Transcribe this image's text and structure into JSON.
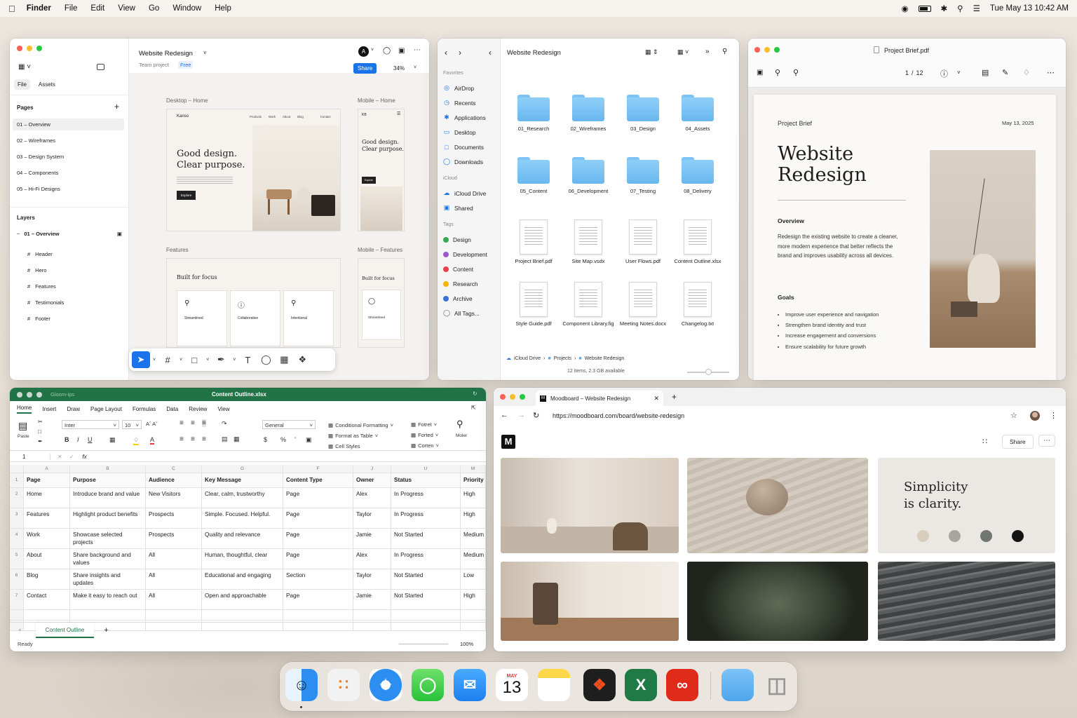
{
  "menubar": {
    "app": "Finder",
    "items": [
      "File",
      "Edit",
      "View",
      "Go",
      "Window",
      "Help"
    ],
    "datetime": "Tue May 13  10:42 AM"
  },
  "figma": {
    "title": "Website Redesign",
    "subtitle": "Team project",
    "plan": "Free",
    "avatar": "A",
    "share": "Share",
    "zoom": "34%",
    "tabs": [
      "File",
      "Assets"
    ],
    "pages_title": "Pages",
    "pages": [
      "01 – Overview",
      "02 – Wireframes",
      "03 – Design System",
      "04 – Components",
      "05 – Hi-Fi Designs"
    ],
    "layers_title": "Layers",
    "layer_root": "01 – Overview",
    "layers": [
      "Header",
      "Hero",
      "Features",
      "Testimonials",
      "Footer"
    ],
    "frames": {
      "desktop_home": "Desktop – Home",
      "mobile_home": "Mobile – Home",
      "features": "Features",
      "mobile_features": "Mobile – Features"
    },
    "hero": {
      "logo": "Kanso",
      "nav": [
        "Products",
        "Work",
        "About",
        "Blog",
        "Contact"
      ],
      "headline1": "Good design.",
      "headline2": "Clear purpose.",
      "cta": "Explore",
      "mobile_logo": "KB"
    },
    "feat": {
      "title": "Built for focus",
      "cards": [
        "Streamlined",
        "Collaborative",
        "Intentional"
      ]
    }
  },
  "finder": {
    "title": "Website Redesign",
    "favorites_title": "Favorites",
    "favorites": [
      {
        "icon": "airdrop-icon",
        "label": "AirDrop"
      },
      {
        "icon": "recents-icon",
        "label": "Recents"
      },
      {
        "icon": "applications-icon",
        "label": "Applications"
      },
      {
        "icon": "desktop-icon",
        "label": "Desktop"
      },
      {
        "icon": "documents-icon",
        "label": "Documents"
      },
      {
        "icon": "downloads-icon",
        "label": "Downloads"
      }
    ],
    "icloud_title": "iCloud",
    "icloud": [
      "iCloud Drive",
      "Shared"
    ],
    "tags_title": "Tags",
    "tags": [
      {
        "label": "Design",
        "color": "#34a853"
      },
      {
        "label": "Development",
        "color": "#9b59d0"
      },
      {
        "label": "Content",
        "color": "#e8414a"
      },
      {
        "label": "Research",
        "color": "#f4b400"
      },
      {
        "label": "Archive",
        "color": "#3b6fd8"
      },
      {
        "label": "All Tags...",
        "color": ""
      }
    ],
    "folders": [
      "01_Research",
      "02_Wireframes",
      "03_Design",
      "04_Assets",
      "05_Content",
      "06_Development",
      "07_Testing",
      "08_Delivery"
    ],
    "files": [
      "Project Brief.pdf",
      "Site Map.vsdx",
      "User Flows.pdf",
      "Content Outline.xlsx",
      "Style Guide.pdf",
      "Component Library.fig",
      "Meeting Notes.docx",
      "Changelog.txt"
    ],
    "path": [
      "iCloud Drive",
      "Projects",
      "Website Redesign"
    ],
    "status": "12 items, 2.3 GB available"
  },
  "pdf": {
    "title": "Project Brief.pdf",
    "page": "1",
    "pages": "12",
    "kicker": "Project Brief",
    "date": "May 13, 2025",
    "h1a": "Website",
    "h1b": "Redesign",
    "overview_title": "Overview",
    "overview": "Redesign the existing website to create a cleaner, more modern experience that better reflects the brand and improves usability across all devices.",
    "goals_title": "Goals",
    "goals": [
      "Improve user experience and navigation",
      "Strengthen brand identity and trust",
      "Increase engagement and conversions",
      "Ensure scalability for future growth"
    ]
  },
  "excel": {
    "title": "Content Outline.xlsx",
    "left_title": "Gloom-ips",
    "tabs": [
      "Home",
      "Insert",
      "Draw",
      "Page Layout",
      "Formulas",
      "Data",
      "Review",
      "View"
    ],
    "font": "Inter",
    "size": "10",
    "numfmt": "General",
    "paste": "Paste",
    "styles": [
      "Conditional Formatting",
      "Format as Table",
      "Cell Styles"
    ],
    "cells": [
      "Fotret",
      "Forted",
      "Corten"
    ],
    "moler": "Moler",
    "namebox": "1",
    "cols": [
      "A",
      "B",
      "C",
      "G",
      "F",
      "J",
      "U",
      "M"
    ],
    "header": [
      "Page",
      "Purpose",
      "Audience",
      "Key Message",
      "Content Type",
      "Owner",
      "Status",
      "Priority"
    ],
    "rows": [
      [
        "Home",
        "Introduce brand and value",
        "New Visitors",
        "Clear, calm, trustworthy",
        "Page",
        "Alex",
        "In Progress",
        "High"
      ],
      [
        "Features",
        "Highlight product benefits",
        "Prospects",
        "Simple. Focused. Helpful.",
        "Page",
        "Taylor",
        "In Progress",
        "High"
      ],
      [
        "Work",
        "Showcase selected projects",
        "Prospects",
        "Quality and relevance",
        "Page",
        "Jamie",
        "Not Started",
        "Medium"
      ],
      [
        "About",
        "Share background and values",
        "All",
        "Human, thoughtful, clear",
        "Page",
        "Alex",
        "In Progress",
        "Medium"
      ],
      [
        "Blog",
        "Share insights and updates",
        "All",
        "Educational and engaging",
        "Section",
        "Taylor",
        "Not Started",
        "Low"
      ],
      [
        "Contact",
        "Make it easy to reach out",
        "All",
        "Open and approachable",
        "Page",
        "Jamie",
        "Not Started",
        "High"
      ]
    ],
    "sheet": "Content Outline",
    "status": "Ready",
    "zoom": "100%"
  },
  "browser": {
    "tab": "Moodboard – Website Redesign",
    "url": "https://moodboard.com/board/website-redesign",
    "logo": "M",
    "share": "Share",
    "quote1": "Simplicity",
    "quote2": "is clarity.",
    "swatches": [
      "#d9cdbd",
      "#a9a59e",
      "#6f7770",
      "#141414"
    ]
  },
  "dock": {
    "calendar_month": "MAY",
    "calendar_day": "13"
  }
}
